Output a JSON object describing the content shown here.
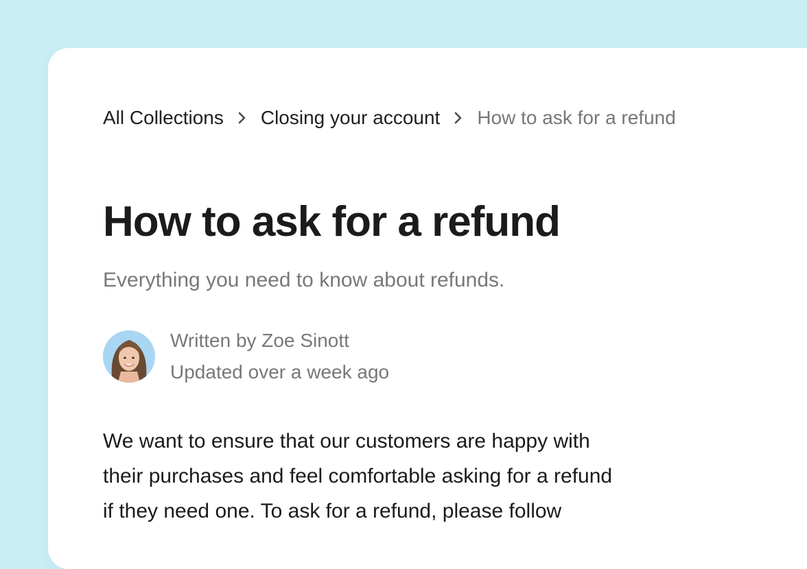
{
  "colors": {
    "page_background": "#c9eef6",
    "card_background": "#ffffff",
    "text_primary": "#1b1b1b",
    "text_secondary": "#787878"
  },
  "breadcrumb": {
    "items": [
      {
        "label": "All Collections"
      },
      {
        "label": "Closing your account"
      },
      {
        "label": "How to ask for a refund"
      }
    ],
    "separator_icon": "chevron-right-icon"
  },
  "article": {
    "title": "How to ask for a refund",
    "subtitle": "Everything you need to know about refunds.",
    "author": {
      "written_by": "Written by Zoe Sinott",
      "updated": "Updated over a week ago",
      "avatar_icon": "author-avatar"
    },
    "body_lines": [
      "We want to ensure that our customers are happy with",
      "their purchases and feel comfortable asking for a refund",
      "if they need one. To ask for a refund, please follow"
    ]
  }
}
